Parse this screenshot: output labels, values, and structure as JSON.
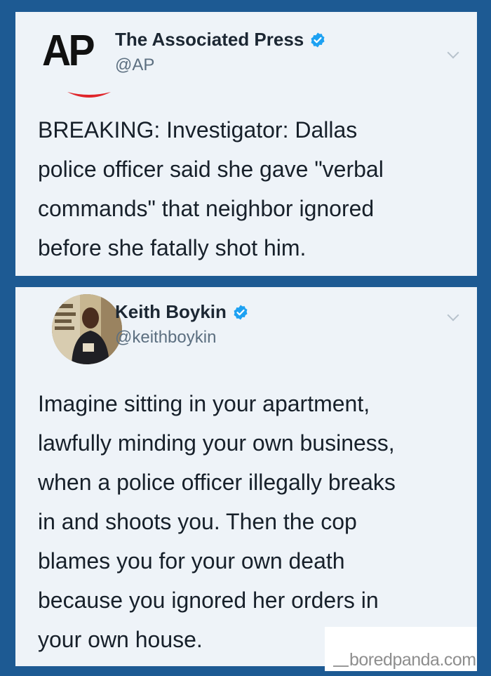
{
  "tweets": [
    {
      "name": "The Associated Press",
      "handle": "@AP",
      "avatar_text": "AP",
      "verified": true,
      "text": "BREAKING: Investigator: Dallas\npolice officer said she gave \"verbal\ncommands\" that neighbor ignored\nbefore she fatally shot him."
    },
    {
      "name": "Keith Boykin",
      "handle": "@keithboykin",
      "verified": true,
      "text": "Imagine sitting in your apartment,\nlawfully minding your own business,\nwhen a police officer illegally breaks\nin and shoots you. Then the cop\nblames you for your own death\nbecause you ignored her orders in\nyour own house."
    }
  ],
  "watermark": "boredpanda.com",
  "colors": {
    "background": "#1d5a93",
    "card": "#eef3f8",
    "verified": "#1da1f2",
    "ap_smile": "#e0252b"
  }
}
